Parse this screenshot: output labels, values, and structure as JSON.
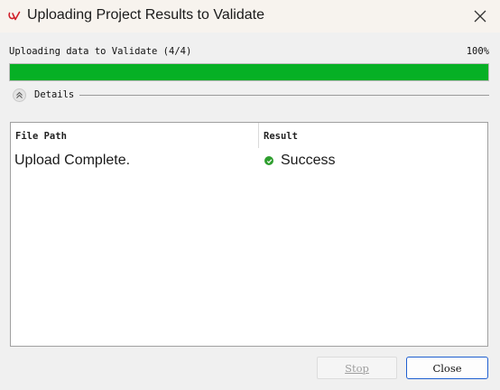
{
  "window": {
    "title": "Uploading Project Results to Validate",
    "icon": "qv-app-icon",
    "close_icon": "close-icon"
  },
  "progress": {
    "status": "Uploading data to Validate (4/4)",
    "percent_label": "100%",
    "value": 100,
    "color": "#06b025"
  },
  "details": {
    "label": "Details",
    "toggle_icon": "chevron-up-icon"
  },
  "table": {
    "columns": [
      "File Path",
      "Result"
    ],
    "rows": [
      {
        "file_path": "Upload Complete.",
        "result": "Success",
        "result_icon": "success-check-icon",
        "result_color": "#2e9e2e"
      }
    ]
  },
  "buttons": {
    "stop": "Stop",
    "close": "Close"
  }
}
